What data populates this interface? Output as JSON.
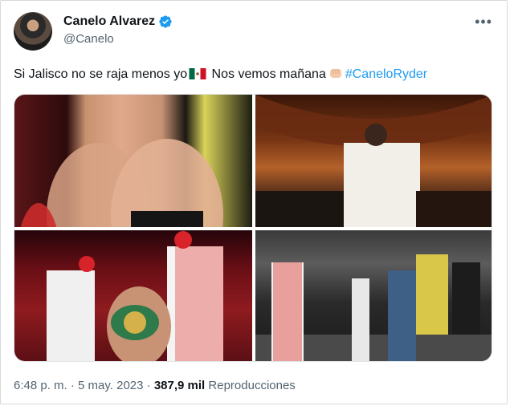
{
  "author": {
    "name": "Canelo Alvarez",
    "handle": "@Canelo"
  },
  "tweet": {
    "text_before_flag": "Si Jalisco no se raja menos yo",
    "text_after_flag": " Nos vemos mañana",
    "hashtag": "#CaneloRyder"
  },
  "meta": {
    "time": "6:48 p. m.",
    "separator": " · ",
    "date": "5 may. 2023",
    "views_count": "387,9 mil",
    "views_label": "Reproducciones"
  },
  "colors": {
    "accent": "#1d9bf0",
    "text": "#0f1419",
    "muted": "#536471"
  },
  "icons": [
    "verified-badge-icon",
    "more-options-icon",
    "mexico-flag-emoji",
    "raised-fist-emoji"
  ]
}
